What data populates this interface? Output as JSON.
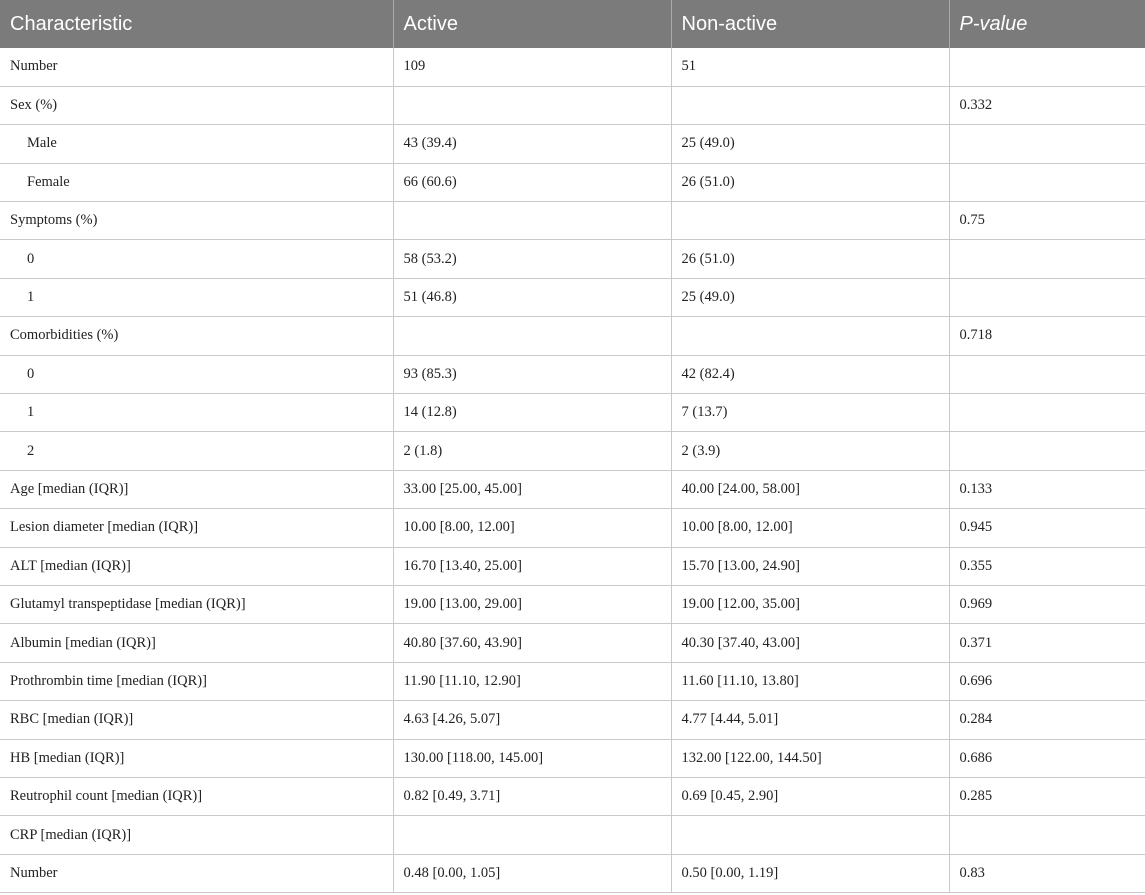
{
  "table": {
    "headers": [
      "Characteristic",
      "Active",
      "Non-active",
      "P-value"
    ],
    "rows": [
      {
        "label": "Number",
        "indent": false,
        "active": "109",
        "nonactive": "51",
        "p": ""
      },
      {
        "label": "Sex (%)",
        "indent": false,
        "active": "",
        "nonactive": "",
        "p": "0.332"
      },
      {
        "label": "Male",
        "indent": true,
        "active": "43 (39.4)",
        "nonactive": "25 (49.0)",
        "p": ""
      },
      {
        "label": "Female",
        "indent": true,
        "active": "66 (60.6)",
        "nonactive": "26 (51.0)",
        "p": ""
      },
      {
        "label": "Symptoms (%)",
        "indent": false,
        "active": "",
        "nonactive": "",
        "p": "0.75"
      },
      {
        "label": "0",
        "indent": true,
        "active": "58 (53.2)",
        "nonactive": "26 (51.0)",
        "p": ""
      },
      {
        "label": "1",
        "indent": true,
        "active": "51 (46.8)",
        "nonactive": "25 (49.0)",
        "p": ""
      },
      {
        "label": "Comorbidities (%)",
        "indent": false,
        "active": "",
        "nonactive": "",
        "p": "0.718"
      },
      {
        "label": "0",
        "indent": true,
        "active": "93 (85.3)",
        "nonactive": "42 (82.4)",
        "p": ""
      },
      {
        "label": "1",
        "indent": true,
        "active": "14 (12.8)",
        "nonactive": "7 (13.7)",
        "p": ""
      },
      {
        "label": "2",
        "indent": true,
        "active": "2 (1.8)",
        "nonactive": "2 (3.9)",
        "p": ""
      },
      {
        "label": "Age [median (IQR)]",
        "indent": false,
        "active": "33.00 [25.00, 45.00]",
        "nonactive": "40.00 [24.00, 58.00]",
        "p": "0.133"
      },
      {
        "label": "Lesion diameter [median (IQR)]",
        "indent": false,
        "active": "10.00 [8.00, 12.00]",
        "nonactive": "10.00 [8.00, 12.00]",
        "p": "0.945"
      },
      {
        "label": "ALT [median (IQR)]",
        "indent": false,
        "active": "16.70 [13.40, 25.00]",
        "nonactive": "15.70 [13.00, 24.90]",
        "p": "0.355"
      },
      {
        "label": "Glutamyl transpeptidase [median (IQR)]",
        "indent": false,
        "active": "19.00 [13.00, 29.00]",
        "nonactive": "19.00 [12.00, 35.00]",
        "p": "0.969"
      },
      {
        "label": "Albumin [median (IQR)]",
        "indent": false,
        "active": "40.80 [37.60, 43.90]",
        "nonactive": "40.30 [37.40, 43.00]",
        "p": "0.371"
      },
      {
        "label": "Prothrombin time [median (IQR)]",
        "indent": false,
        "active": "11.90 [11.10, 12.90]",
        "nonactive": "11.60 [11.10, 13.80]",
        "p": "0.696"
      },
      {
        "label": "RBC [median (IQR)]",
        "indent": false,
        "active": "4.63 [4.26, 5.07]",
        "nonactive": "4.77 [4.44, 5.01]",
        "p": "0.284"
      },
      {
        "label": "HB [median (IQR)]",
        "indent": false,
        "active": "130.00 [118.00, 145.00]",
        "nonactive": "132.00 [122.00, 144.50]",
        "p": "0.686"
      },
      {
        "label": "Reutrophil count [median (IQR)]",
        "indent": false,
        "active": "0.82 [0.49, 3.71]",
        "nonactive": "0.69 [0.45, 2.90]",
        "p": "0.285"
      },
      {
        "label": "CRP [median (IQR)]",
        "indent": false,
        "active": "",
        "nonactive": "",
        "p": ""
      },
      {
        "label": "Number",
        "indent": false,
        "active": "0.48 [0.00, 1.05]",
        "nonactive": "0.50 [0.00, 1.19]",
        "p": "0.83"
      }
    ]
  }
}
